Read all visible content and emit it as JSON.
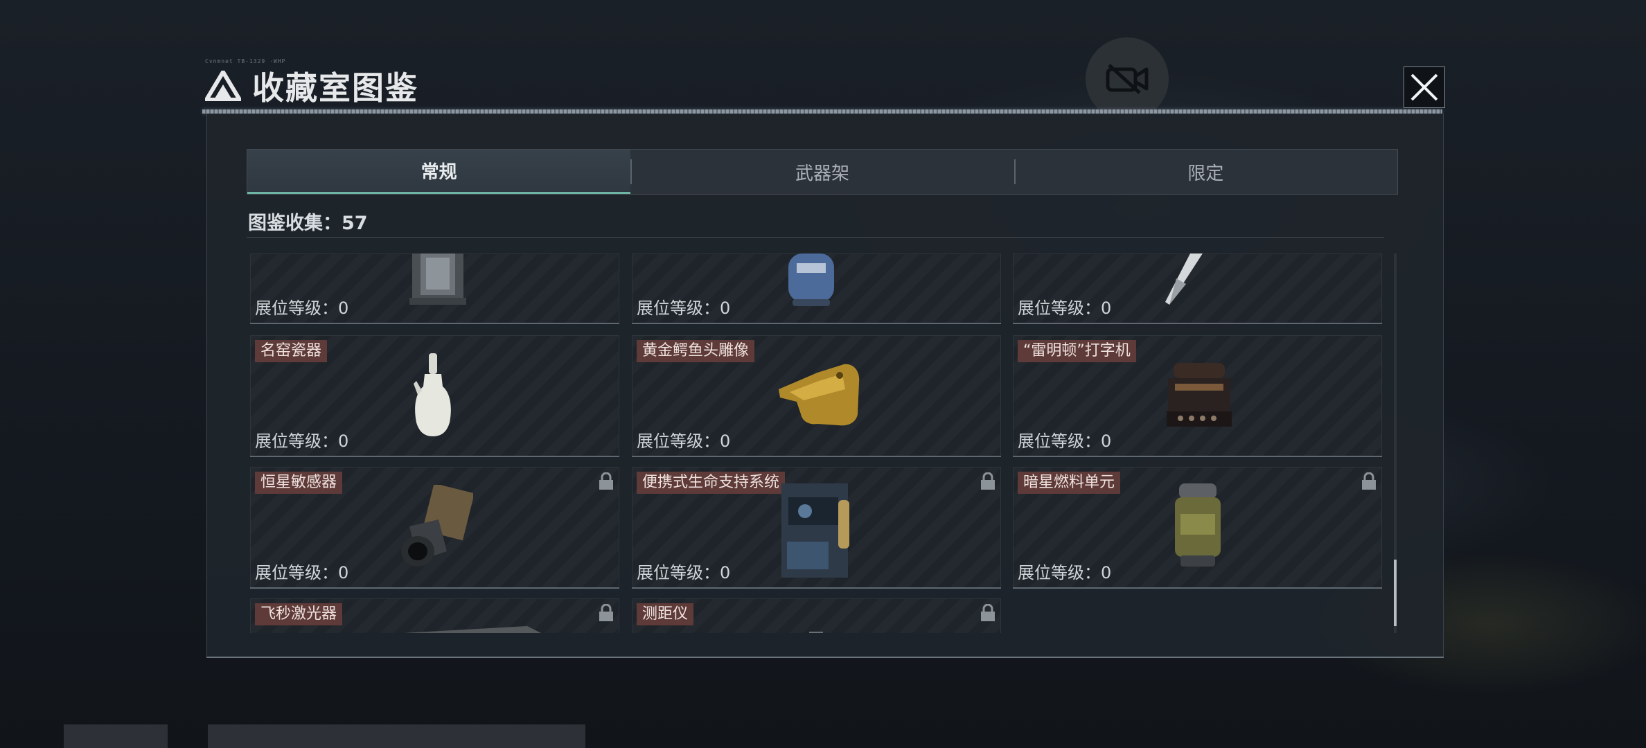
{
  "window": {
    "title": "收藏室图鉴",
    "tiny_caption": "Cvnmnet TB-1329 ·WHP"
  },
  "tabs": [
    {
      "label": "常规",
      "active": true
    },
    {
      "label": "武器架",
      "active": false
    },
    {
      "label": "限定",
      "active": false
    }
  ],
  "collection": {
    "label": "图鉴收集：57"
  },
  "cards": [
    {
      "name": "",
      "level": "展位等级：0",
      "locked": false,
      "icon": "lantern-icon"
    },
    {
      "name": "",
      "level": "展位等级：0",
      "locked": false,
      "icon": "gas-canister-icon"
    },
    {
      "name": "",
      "level": "展位等级：0",
      "locked": false,
      "icon": "fountain-pen-icon"
    },
    {
      "name": "名窑瓷器",
      "level": "展位等级：0",
      "locked": false,
      "icon": "porcelain-vase-icon"
    },
    {
      "name": "黄金鳄鱼头雕像",
      "level": "展位等级：0",
      "locked": false,
      "icon": "golden-crocodile-icon"
    },
    {
      "name": "“雷明顿”打字机",
      "level": "展位等级：0",
      "locked": false,
      "icon": "typewriter-icon"
    },
    {
      "name": "恒星敏感器",
      "level": "展位等级：0",
      "locked": true,
      "icon": "star-sensor-icon"
    },
    {
      "name": "便携式生命支持系统",
      "level": "展位等级：0",
      "locked": true,
      "icon": "life-support-icon"
    },
    {
      "name": "暗星燃料单元",
      "level": "展位等级：0",
      "locked": true,
      "icon": "fuel-cell-icon"
    },
    {
      "name": "飞秒激光器",
      "level": "",
      "locked": true,
      "icon": "laser-icon"
    },
    {
      "name": "测距仪",
      "level": "",
      "locked": true,
      "icon": "rangefinder-icon"
    }
  ],
  "colors": {
    "tab_accent": "#6fb5a3",
    "name_tag": "#5e3a38",
    "panel": "#1e242b"
  }
}
